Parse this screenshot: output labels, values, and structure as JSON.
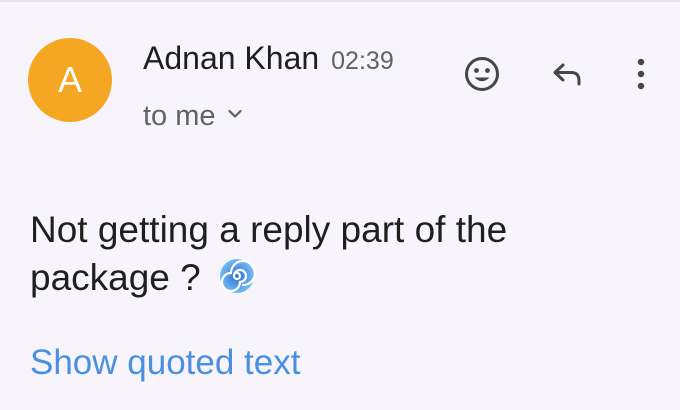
{
  "email": {
    "sender": {
      "initial": "A",
      "name": "Adnan Khan",
      "time": "02:39",
      "avatar_color": "#f5a623"
    },
    "recipient_label": "to me",
    "body_text": "Not getting a reply part of the package ?",
    "body_emoji": "cyclone-emoji",
    "quoted_link": "Show quoted text"
  },
  "toolbar": {
    "icons": [
      "add-reaction-icon",
      "reply-icon",
      "more-options-icon"
    ]
  },
  "colors": {
    "link": "#4a8fe0",
    "secondary_text": "#5f6368",
    "background": "#f7f5fb"
  }
}
